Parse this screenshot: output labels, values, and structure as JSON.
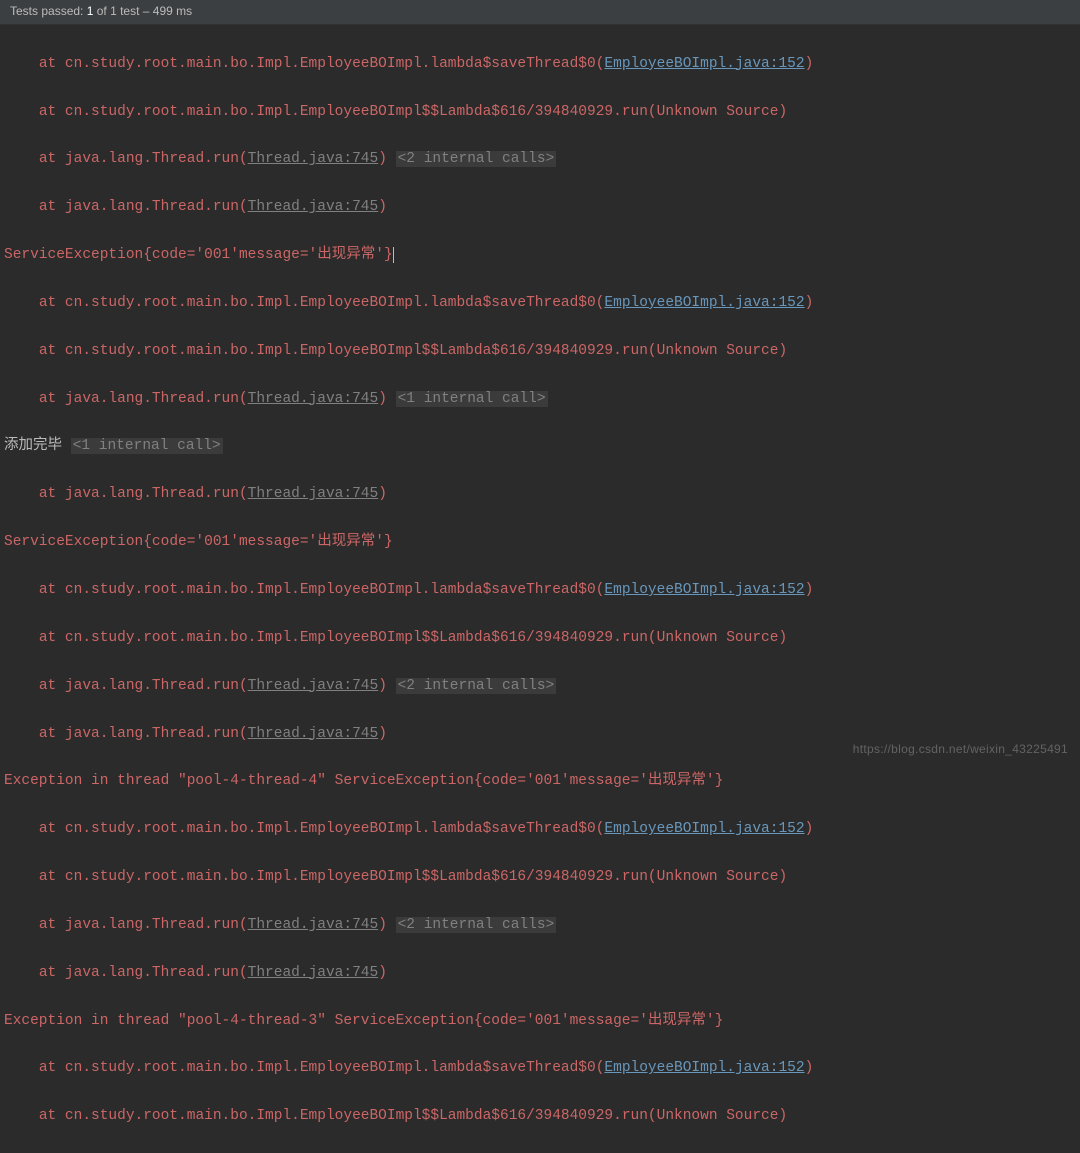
{
  "header": {
    "prefix": "Tests passed: ",
    "count": "1",
    "mid": " of 1 test – ",
    "time": "499 ms"
  },
  "indent": "    ",
  "at": "at ",
  "trace": {
    "boImplLambda": "cn.study.root.main.bo.Impl.EmployeeBOImpl.lambda$saveThread$0",
    "boImplLambdaRun": "cn.study.root.main.bo.Impl.EmployeeBOImpl$$Lambda$616/394840929.run(Unknown Source)",
    "threadRun": "java.lang.Thread.run",
    "linkBoImpl": "EmployeeBOImpl.java:152",
    "linkThread": "Thread.java:745",
    "openParen": "(",
    "closeParen": ")"
  },
  "tags": {
    "twoInternal": "<2 internal calls>",
    "oneInternal": "<1 internal call>",
    "oneInternalPlain": "<1 internal call>"
  },
  "msgs": {
    "serviceEx": "ServiceException{code='001'message='出现异常'}",
    "serviceExCursor": "ServiceException{code='001'message='出现异常'}",
    "addDone": "添加完毕 ",
    "exThread4": "Exception in thread \"pool-4-thread-4\" ServiceException{code='001'message='出现异常'}",
    "exThread3": "Exception in thread \"pool-4-thread-3\" ServiceException{code='001'message='出现异常'}"
  },
  "watermark": "https://blog.csdn.net/weixin_43225491"
}
